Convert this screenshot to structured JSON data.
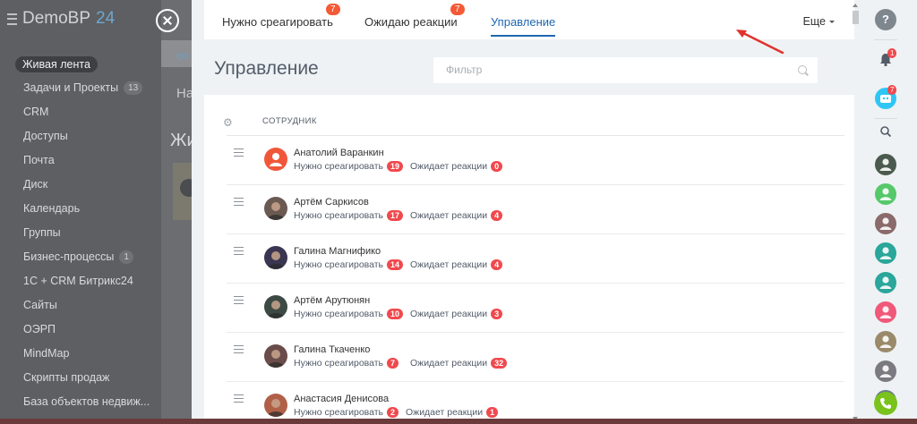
{
  "brand": {
    "name": "DemoBP",
    "number": "24"
  },
  "sidebar": {
    "items": [
      {
        "label": "Живая лента",
        "active": true
      },
      {
        "label": "Задачи и Проекты",
        "count": "13"
      },
      {
        "label": "CRM"
      },
      {
        "label": "Доступы"
      },
      {
        "label": "Почта"
      },
      {
        "label": "Диск"
      },
      {
        "label": "Календарь"
      },
      {
        "label": "Группы"
      },
      {
        "label": "Бизнес-процессы",
        "count": "1"
      },
      {
        "label": "1С + CRM Битрикс24"
      },
      {
        "label": "Сайты"
      },
      {
        "label": "ОЭРП"
      },
      {
        "label": "MindMap"
      },
      {
        "label": "Скрипты продаж"
      },
      {
        "label": "База объектов недвиж..."
      }
    ]
  },
  "background_page": {
    "tab_fragment": "со",
    "heading_fragment": "На",
    "title_fragment": "Жи"
  },
  "tabs": [
    {
      "label": "Нужно среагировать",
      "badge": "7"
    },
    {
      "label": "Ожидаю реакции",
      "badge": "7"
    },
    {
      "label": "Управление",
      "active": true
    }
  ],
  "more_label": "Еще",
  "page_title": "Управление",
  "filter": {
    "placeholder": "Фильтр"
  },
  "table": {
    "column_header": "сотрудник",
    "react_label": "Нужно среагировать",
    "wait_label": "Ожидает реакции",
    "rows": [
      {
        "name": "Анатолий Варанкин",
        "react": "19",
        "wait": "0",
        "avatar": "default-user-icon",
        "color": "#f0573a"
      },
      {
        "name": "Артём Саркисов",
        "react": "17",
        "wait": "4",
        "avatar": "photo",
        "color": "#6b5a52"
      },
      {
        "name": "Галина Магнифико",
        "react": "14",
        "wait": "4",
        "avatar": "photo",
        "color": "#3a3550"
      },
      {
        "name": "Артём Арутюнян",
        "react": "10",
        "wait": "3",
        "avatar": "photo",
        "color": "#3d4a44"
      },
      {
        "name": "Галина Ткаченко",
        "react": "7",
        "wait": "32",
        "avatar": "photo",
        "color": "#6a4c4a"
      },
      {
        "name": "Анастасия Денисова",
        "react": "2",
        "wait": "1",
        "avatar": "photo",
        "color": "#b06048"
      }
    ]
  },
  "rightbar": {
    "notifications_badge": "1",
    "bot_badge": "7",
    "accent": "#2fc6f6",
    "phone_color": "#7ac21c"
  },
  "colors": {
    "active_tab": "#2067b0",
    "badge": "#f45a36",
    "counter": "#f0494e"
  }
}
